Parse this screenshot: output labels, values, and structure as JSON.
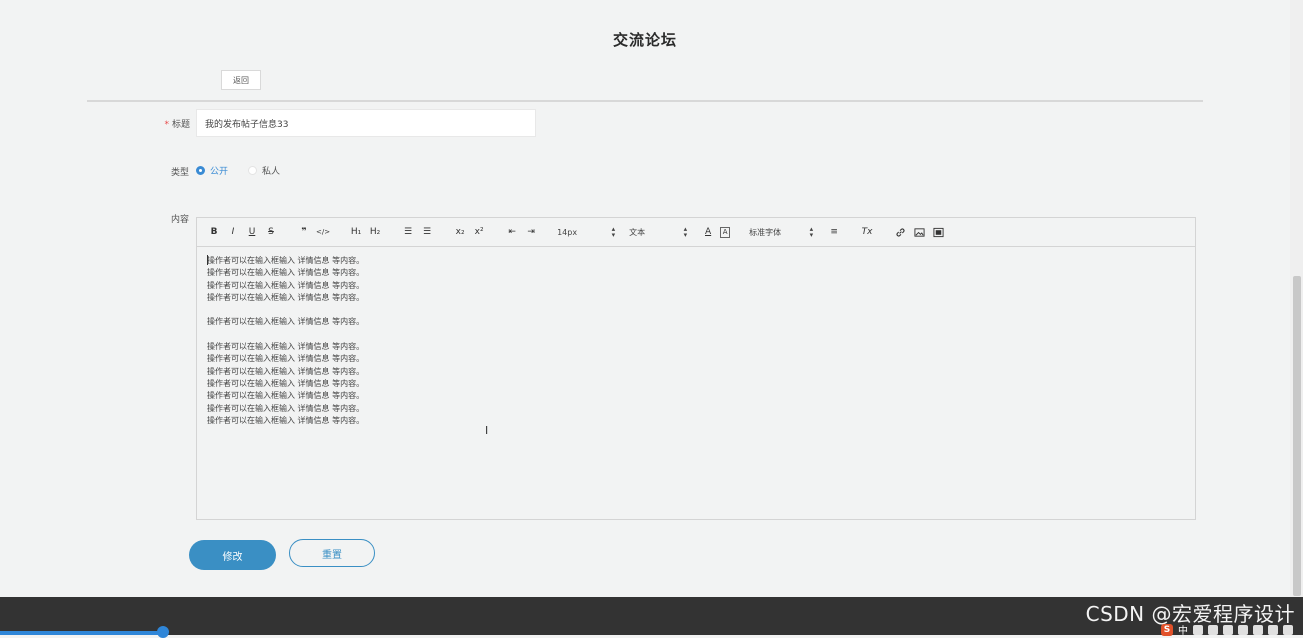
{
  "page": {
    "title": "交流论坛",
    "back_label": "返回"
  },
  "form": {
    "title_field": {
      "label": "标题",
      "required_mark": "*",
      "value": "我的发布帖子信息33"
    },
    "type_field": {
      "label": "类型",
      "options": [
        {
          "label": "公开",
          "checked": true
        },
        {
          "label": "私人",
          "checked": false
        }
      ]
    },
    "content_field": {
      "label": "内容"
    }
  },
  "editor": {
    "toolbar": {
      "bold": "B",
      "italic": "I",
      "underline": "U",
      "strike": "S",
      "blockquote": "❞",
      "code": "</>",
      "h1": "H₁",
      "h2": "H₂",
      "ordered_list": "☰",
      "bullet_list": "☰",
      "subscript": "x₂",
      "superscript": "x²",
      "outdent": "⇤",
      "indent": "⇥",
      "size_select": "14px",
      "header_select": "文本",
      "font_color": "A",
      "background_color": "A",
      "font_select": "标准字体",
      "align": "≡",
      "clean": "Tx"
    },
    "content": "操作者可以在输入框输入 详情信息 等内容。\n操作者可以在输入框输入 详情信息 等内容。\n操作者可以在输入框输入 详情信息 等内容。\n操作者可以在输入框输入 详情信息 等内容。\n\n操作者可以在输入框输入 详情信息 等内容。\n\n操作者可以在输入框输入 详情信息 等内容。\n操作者可以在输入框输入 详情信息 等内容。\n操作者可以在输入框输入 详情信息 等内容。\n操作者可以在输入框输入 详情信息 等内容。\n操作者可以在输入框输入 详情信息 等内容。\n操作者可以在输入框输入 详情信息 等内容。\n操作者可以在输入框输入 详情信息 等内容。"
  },
  "actions": {
    "submit_label": "修改",
    "reset_label": "重置"
  },
  "footer": {
    "watermark": "CSDN @宏爱程序设计",
    "ime_label": "S",
    "ime_lang": "中"
  },
  "colors": {
    "primary": "#3a8fc4",
    "radio_checked": "#3a8bd4",
    "required": "#e84a4a",
    "taskbar": "#333333"
  }
}
